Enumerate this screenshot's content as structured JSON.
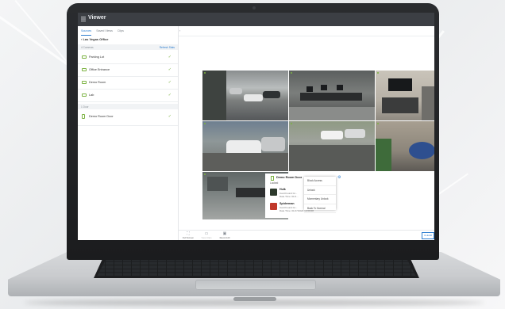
{
  "app": {
    "title": "Viewer"
  },
  "sidebar": {
    "tabs": [
      {
        "label": "Sources"
      },
      {
        "label": "Saved Views"
      },
      {
        "label": "Clips"
      }
    ],
    "site": "Las Vegas Office",
    "cameras_header": "4 Cameras",
    "refresh_label": "Refresh Stats",
    "cameras": [
      {
        "label": "Parking Lot"
      },
      {
        "label": "Office Entrance"
      },
      {
        "label": "Demo Room"
      },
      {
        "label": "Lab"
      }
    ],
    "doors_header": "1 Door",
    "doors": [
      {
        "label": "Demo Room Door"
      }
    ]
  },
  "main": {
    "collapse_icon": "chevron-left-icon"
  },
  "door_panel": {
    "title": "Demo Room Door",
    "status": "Locked",
    "events": [
      {
        "name": "Hulk",
        "line1": "Card Found Gr...",
        "line2": "Date Time: 01/1..."
      },
      {
        "name": "Spiderman",
        "line1": "Card Found Gr...",
        "line2": "Date Time: 01/17/2020 12:09:08"
      }
    ]
  },
  "context_menu": [
    "Block Access",
    "Unlock",
    "Momentary Unlock",
    "Back To Normal"
  ],
  "toolbar": {
    "full_screen": "Full Screen",
    "view_clips": "View Clips",
    "record_all": "Record All",
    "clear": "CLEAR"
  },
  "colors": {
    "accent": "#2f7fd0",
    "online": "#7cb342",
    "titlebar": "#3c3f44"
  }
}
